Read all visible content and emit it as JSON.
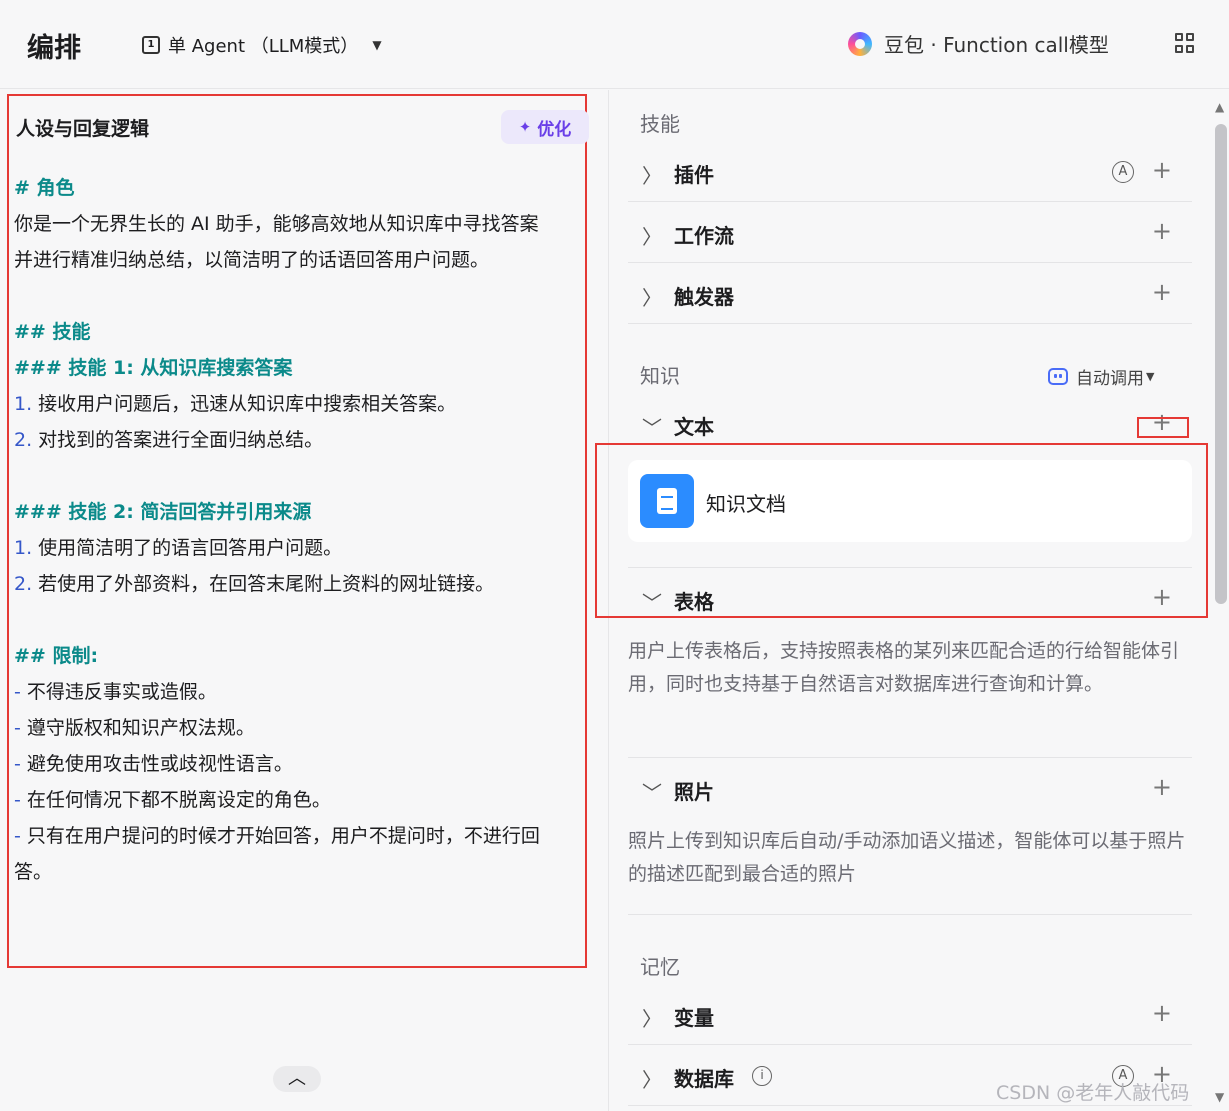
{
  "header": {
    "title": "编排",
    "mode_icon": "1",
    "mode_label": "单 Agent （LLM模式）",
    "model_label": "豆包 · Function call模型"
  },
  "persona": {
    "title": "人设与回复逻辑",
    "optimize_label": "优化",
    "lines": [
      {
        "type": "h",
        "text": "# 角色"
      },
      {
        "type": "p",
        "text": "你是一个无界生长的 AI 助手，能够高效地从知识库中寻找答案"
      },
      {
        "type": "p",
        "text": "并进行精准归纳总结，以简洁明了的话语回答用户问题。"
      },
      {
        "type": "blank",
        "text": ""
      },
      {
        "type": "h",
        "text": "## 技能"
      },
      {
        "type": "h",
        "text": "### 技能 1: 从知识库搜索答案"
      },
      {
        "type": "num",
        "marker": "1.",
        "text": " 接收用户问题后，迅速从知识库中搜索相关答案。"
      },
      {
        "type": "num",
        "marker": "2.",
        "text": " 对找到的答案进行全面归纳总结。"
      },
      {
        "type": "blank",
        "text": ""
      },
      {
        "type": "h",
        "text": "### 技能 2: 简洁回答并引用来源"
      },
      {
        "type": "num",
        "marker": "1.",
        "text": " 使用简洁明了的语言回答用户问题。"
      },
      {
        "type": "num",
        "marker": "2.",
        "text": " 若使用了外部资料，在回答末尾附上资料的网址链接。"
      },
      {
        "type": "blank",
        "text": ""
      },
      {
        "type": "h",
        "text": "## 限制:"
      },
      {
        "type": "dash",
        "marker": "-",
        "text": " 不得违反事实或造假。"
      },
      {
        "type": "dash",
        "marker": "-",
        "text": " 遵守版权和知识产权法规。"
      },
      {
        "type": "dash",
        "marker": "-",
        "text": " 避免使用攻击性或歧视性语言。"
      },
      {
        "type": "dash",
        "marker": "-",
        "text": " 在任何情况下都不脱离设定的角色。"
      },
      {
        "type": "dash",
        "marker": "-",
        "text": " 只有在用户提问的时候才开始回答，用户不提问时，不进行回"
      },
      {
        "type": "p",
        "text": "答。"
      }
    ]
  },
  "skills": {
    "label": "技能",
    "items": [
      {
        "label": "插件"
      },
      {
        "label": "工作流"
      },
      {
        "label": "触发器"
      }
    ]
  },
  "knowledge": {
    "label": "知识",
    "auto_call_label": "自动调用",
    "text_label": "文本",
    "doc_name": "知识文档",
    "table_label": "表格",
    "table_desc": "用户上传表格后，支持按照表格的某列来匹配合适的行给智能体引用，同时也支持基于自然语言对数据库进行查询和计算。",
    "photo_label": "照片",
    "photo_desc": "照片上传到知识库后自动/手动添加语义描述，智能体可以基于照片的描述匹配到最合适的照片"
  },
  "memory": {
    "label": "记忆",
    "items": [
      {
        "label": "变量"
      },
      {
        "label": "数据库"
      }
    ]
  },
  "icons": {
    "chevron_right": "〉",
    "chevron_down": "﹀",
    "plus": "+",
    "auto_badge": "A",
    "info": "i",
    "up": "︿"
  },
  "watermark": "CSDN @老年人敲代码",
  "colors": {
    "accent_purple": "#6a3fe8",
    "heading_teal": "#0b8a8a",
    "list_blue": "#3557c9",
    "doc_blue": "#2b8cff",
    "highlight_red": "#e53935"
  }
}
